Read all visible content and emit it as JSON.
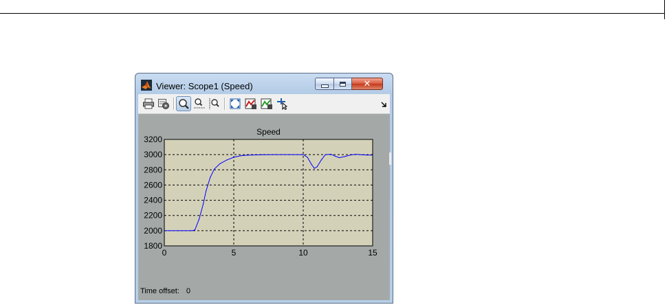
{
  "window": {
    "title": "Viewer: Scope1 (Speed)",
    "controls": {
      "minimize": "minimize",
      "maximize": "maximize",
      "close": "close"
    }
  },
  "toolbar": {
    "icons": [
      "print-icon",
      "parameters-icon",
      "zoom-icon",
      "zoom-x-icon",
      "zoom-y-icon",
      "autoscale-icon",
      "save-axes-icon",
      "restore-axes-icon",
      "signal-selection-icon",
      "toolbar-overflow-icon"
    ],
    "active": "zoom-icon"
  },
  "colors": {
    "plot_background": "#d4d1b9",
    "figure_background": "#a4a9a8",
    "line": "#0000ff",
    "title_bar": "#c2d6ee",
    "close_button": "#d24b2e"
  },
  "chart_data": {
    "type": "line",
    "title": "Speed",
    "xlabel": "",
    "ylabel": "",
    "xlim": [
      0,
      15
    ],
    "ylim": [
      1800,
      3200
    ],
    "xticks": [
      0,
      5,
      10,
      15
    ],
    "yticks": [
      1800,
      2000,
      2200,
      2400,
      2600,
      2800,
      3000,
      3200
    ],
    "grid": true,
    "series": [
      {
        "x": [
          0,
          1,
          2,
          2.2,
          2.5,
          2.8,
          3.0,
          3.3,
          3.6,
          4.0,
          4.5,
          5.0,
          5.5,
          6.0,
          7.0,
          8.0,
          9.0,
          10.0,
          10.3,
          10.6,
          10.8,
          11.0,
          11.3,
          11.6,
          12.0,
          12.3,
          12.6,
          13.0,
          13.4,
          13.8,
          14.2,
          14.6,
          15.0
        ],
        "y": [
          2000,
          2000,
          2000,
          2010,
          2150,
          2350,
          2520,
          2700,
          2810,
          2880,
          2930,
          2965,
          2985,
          2993,
          2998,
          3000,
          3000,
          3000,
          2965,
          2870,
          2820,
          2840,
          2930,
          3000,
          3005,
          2980,
          2960,
          2975,
          2995,
          3005,
          2998,
          2995,
          2995
        ]
      }
    ]
  },
  "status": {
    "time_offset_label": "Time offset:",
    "time_offset_value": "0"
  }
}
